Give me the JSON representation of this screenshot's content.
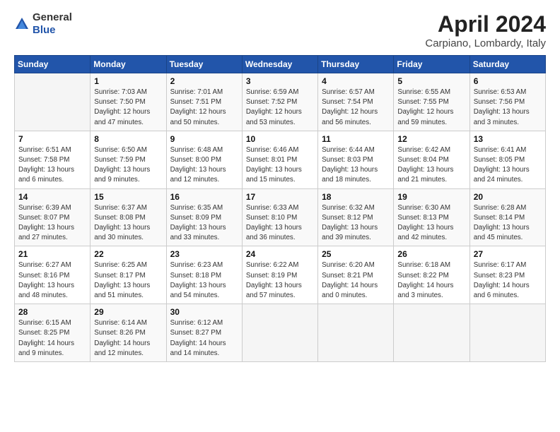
{
  "logo": {
    "general": "General",
    "blue": "Blue"
  },
  "header": {
    "month": "April 2024",
    "location": "Carpiano, Lombardy, Italy"
  },
  "weekdays": [
    "Sunday",
    "Monday",
    "Tuesday",
    "Wednesday",
    "Thursday",
    "Friday",
    "Saturday"
  ],
  "weeks": [
    [
      {
        "day": "",
        "info": ""
      },
      {
        "day": "1",
        "info": "Sunrise: 7:03 AM\nSunset: 7:50 PM\nDaylight: 12 hours\nand 47 minutes."
      },
      {
        "day": "2",
        "info": "Sunrise: 7:01 AM\nSunset: 7:51 PM\nDaylight: 12 hours\nand 50 minutes."
      },
      {
        "day": "3",
        "info": "Sunrise: 6:59 AM\nSunset: 7:52 PM\nDaylight: 12 hours\nand 53 minutes."
      },
      {
        "day": "4",
        "info": "Sunrise: 6:57 AM\nSunset: 7:54 PM\nDaylight: 12 hours\nand 56 minutes."
      },
      {
        "day": "5",
        "info": "Sunrise: 6:55 AM\nSunset: 7:55 PM\nDaylight: 12 hours\nand 59 minutes."
      },
      {
        "day": "6",
        "info": "Sunrise: 6:53 AM\nSunset: 7:56 PM\nDaylight: 13 hours\nand 3 minutes."
      }
    ],
    [
      {
        "day": "7",
        "info": "Sunrise: 6:51 AM\nSunset: 7:58 PM\nDaylight: 13 hours\nand 6 minutes."
      },
      {
        "day": "8",
        "info": "Sunrise: 6:50 AM\nSunset: 7:59 PM\nDaylight: 13 hours\nand 9 minutes."
      },
      {
        "day": "9",
        "info": "Sunrise: 6:48 AM\nSunset: 8:00 PM\nDaylight: 13 hours\nand 12 minutes."
      },
      {
        "day": "10",
        "info": "Sunrise: 6:46 AM\nSunset: 8:01 PM\nDaylight: 13 hours\nand 15 minutes."
      },
      {
        "day": "11",
        "info": "Sunrise: 6:44 AM\nSunset: 8:03 PM\nDaylight: 13 hours\nand 18 minutes."
      },
      {
        "day": "12",
        "info": "Sunrise: 6:42 AM\nSunset: 8:04 PM\nDaylight: 13 hours\nand 21 minutes."
      },
      {
        "day": "13",
        "info": "Sunrise: 6:41 AM\nSunset: 8:05 PM\nDaylight: 13 hours\nand 24 minutes."
      }
    ],
    [
      {
        "day": "14",
        "info": "Sunrise: 6:39 AM\nSunset: 8:07 PM\nDaylight: 13 hours\nand 27 minutes."
      },
      {
        "day": "15",
        "info": "Sunrise: 6:37 AM\nSunset: 8:08 PM\nDaylight: 13 hours\nand 30 minutes."
      },
      {
        "day": "16",
        "info": "Sunrise: 6:35 AM\nSunset: 8:09 PM\nDaylight: 13 hours\nand 33 minutes."
      },
      {
        "day": "17",
        "info": "Sunrise: 6:33 AM\nSunset: 8:10 PM\nDaylight: 13 hours\nand 36 minutes."
      },
      {
        "day": "18",
        "info": "Sunrise: 6:32 AM\nSunset: 8:12 PM\nDaylight: 13 hours\nand 39 minutes."
      },
      {
        "day": "19",
        "info": "Sunrise: 6:30 AM\nSunset: 8:13 PM\nDaylight: 13 hours\nand 42 minutes."
      },
      {
        "day": "20",
        "info": "Sunrise: 6:28 AM\nSunset: 8:14 PM\nDaylight: 13 hours\nand 45 minutes."
      }
    ],
    [
      {
        "day": "21",
        "info": "Sunrise: 6:27 AM\nSunset: 8:16 PM\nDaylight: 13 hours\nand 48 minutes."
      },
      {
        "day": "22",
        "info": "Sunrise: 6:25 AM\nSunset: 8:17 PM\nDaylight: 13 hours\nand 51 minutes."
      },
      {
        "day": "23",
        "info": "Sunrise: 6:23 AM\nSunset: 8:18 PM\nDaylight: 13 hours\nand 54 minutes."
      },
      {
        "day": "24",
        "info": "Sunrise: 6:22 AM\nSunset: 8:19 PM\nDaylight: 13 hours\nand 57 minutes."
      },
      {
        "day": "25",
        "info": "Sunrise: 6:20 AM\nSunset: 8:21 PM\nDaylight: 14 hours\nand 0 minutes."
      },
      {
        "day": "26",
        "info": "Sunrise: 6:18 AM\nSunset: 8:22 PM\nDaylight: 14 hours\nand 3 minutes."
      },
      {
        "day": "27",
        "info": "Sunrise: 6:17 AM\nSunset: 8:23 PM\nDaylight: 14 hours\nand 6 minutes."
      }
    ],
    [
      {
        "day": "28",
        "info": "Sunrise: 6:15 AM\nSunset: 8:25 PM\nDaylight: 14 hours\nand 9 minutes."
      },
      {
        "day": "29",
        "info": "Sunrise: 6:14 AM\nSunset: 8:26 PM\nDaylight: 14 hours\nand 12 minutes."
      },
      {
        "day": "30",
        "info": "Sunrise: 6:12 AM\nSunset: 8:27 PM\nDaylight: 14 hours\nand 14 minutes."
      },
      {
        "day": "",
        "info": ""
      },
      {
        "day": "",
        "info": ""
      },
      {
        "day": "",
        "info": ""
      },
      {
        "day": "",
        "info": ""
      }
    ]
  ]
}
